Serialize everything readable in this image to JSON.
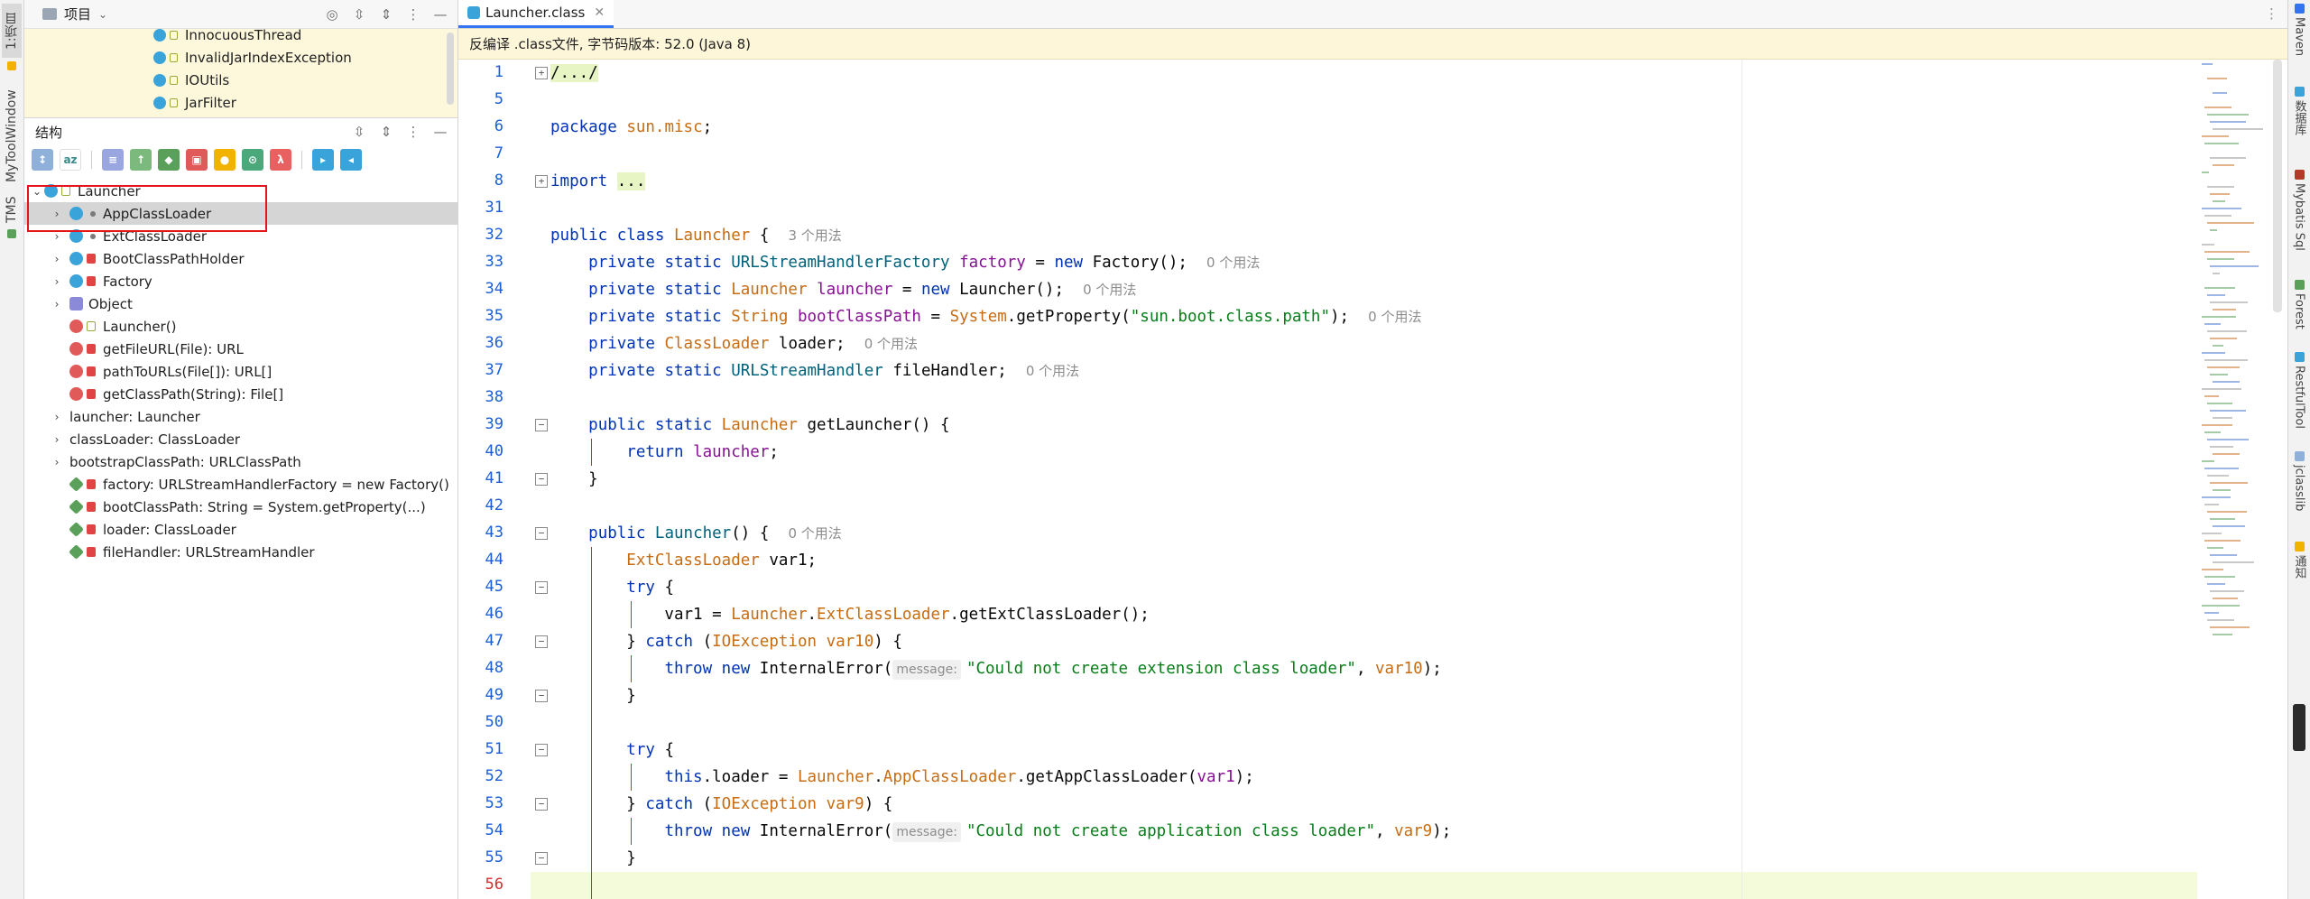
{
  "left_stripe": {
    "tabs": [
      {
        "label": "1:项目",
        "active": true
      },
      {
        "label": "MyToolWindow",
        "active": false
      },
      {
        "label": "TMS",
        "active": false
      }
    ]
  },
  "right_stripe": {
    "tabs": [
      "Maven",
      "数据库",
      "Mybatis Sql",
      "Forest",
      "RestfulTool",
      "jclasslib",
      "通知"
    ]
  },
  "project_pane": {
    "title": "项目",
    "items": [
      "InnocuousThread",
      "InvalidJarIndexException",
      "IOUtils",
      "JarFilter"
    ]
  },
  "structure_pane": {
    "title": "结构",
    "root": "Launcher",
    "rows": [
      {
        "label": "AppClassLoader",
        "arrow": ">",
        "icon": "class",
        "mod": "dot",
        "selected": true
      },
      {
        "label": "ExtClassLoader",
        "arrow": ">",
        "icon": "class",
        "mod": "dot"
      },
      {
        "label": "BootClassPathHolder",
        "arrow": ">",
        "icon": "class",
        "mod": "lock"
      },
      {
        "label": "Factory",
        "arrow": ">",
        "icon": "class",
        "mod": "lock"
      },
      {
        "label": "Object",
        "arrow": ">",
        "icon": "object",
        "mod": ""
      },
      {
        "label": "Launcher()",
        "arrow": "",
        "icon": "method",
        "mod": "lock-g"
      },
      {
        "label": "getFileURL(File): URL",
        "arrow": "",
        "icon": "method",
        "mod": "lock"
      },
      {
        "label": "pathToURLs(File[]): URL[]",
        "arrow": "",
        "icon": "method",
        "mod": "lock"
      },
      {
        "label": "getClassPath(String): File[]",
        "arrow": "",
        "icon": "method",
        "mod": "lock"
      },
      {
        "label": "launcher: Launcher",
        "arrow": ">",
        "icon": "",
        "mod": ""
      },
      {
        "label": "classLoader: ClassLoader",
        "arrow": ">",
        "icon": "",
        "mod": ""
      },
      {
        "label": "bootstrapClassPath: URLClassPath",
        "arrow": ">",
        "icon": "",
        "mod": ""
      },
      {
        "label": "factory: URLStreamHandlerFactory = new Factory()",
        "arrow": "",
        "icon": "field",
        "mod": "lock"
      },
      {
        "label": "bootClassPath: String = System.getProperty(...)",
        "arrow": "",
        "icon": "field",
        "mod": "lock"
      },
      {
        "label": "loader: ClassLoader",
        "arrow": "",
        "icon": "field",
        "mod": "lock"
      },
      {
        "label": "fileHandler: URLStreamHandler",
        "arrow": "",
        "icon": "field",
        "mod": "lock"
      }
    ]
  },
  "editor": {
    "tab_label": "Launcher.class",
    "banner": "反编译 .class文件, 字节码版本: 52.0 (Java 8)",
    "line_numbers": [
      "1",
      "5",
      "6",
      "7",
      "8",
      "31",
      "32",
      "33",
      "34",
      "35",
      "36",
      "37",
      "38",
      "39",
      "40",
      "41",
      "42",
      "43",
      "44",
      "45",
      "46",
      "47",
      "48",
      "49",
      "50",
      "51",
      "52",
      "53",
      "54",
      "55",
      "56"
    ],
    "usage_3": "3 个用法",
    "usage_0": "0 个用法",
    "param_hint": "message:",
    "str_ext": "\"Could not create extension class loader\"",
    "str_app": "\"Could not create application class loader\"",
    "str_prop": "\"sun.boot.class.path\""
  }
}
